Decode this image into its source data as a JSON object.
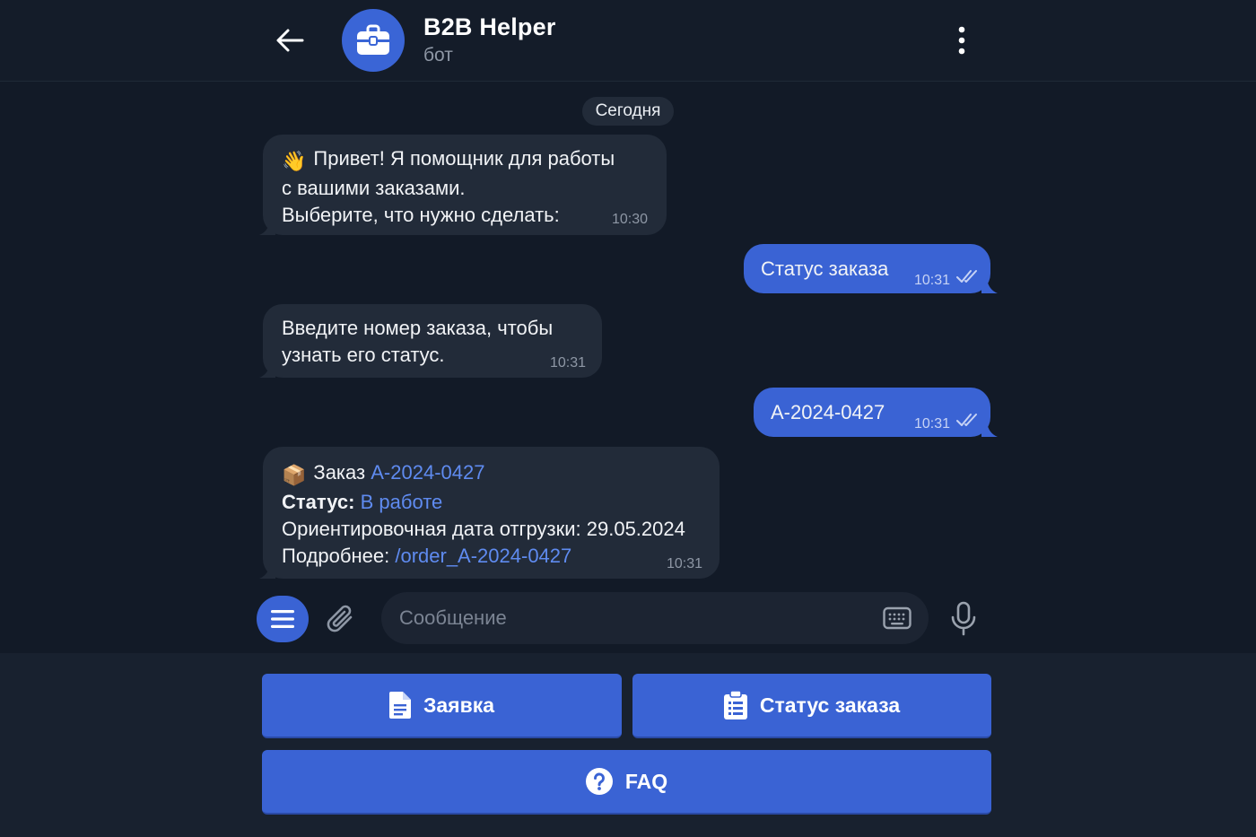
{
  "header": {
    "title": "B2B Helper",
    "subtitle": "бот",
    "back_icon": "arrow-left-icon",
    "avatar_icon": "briefcase-icon",
    "menu_icon": "more-vertical-icon"
  },
  "date_divider": "Сегодня",
  "messages": [
    {
      "direction": "in",
      "emoji": "👋",
      "lines": [
        "Привет! Я помощник для работы",
        "с вашими заказами.",
        "Выберите, что нужно сделать:"
      ],
      "time": "10:30"
    },
    {
      "direction": "out",
      "text": "Статус заказа",
      "time": "10:31",
      "read_icon": "double-check-icon"
    },
    {
      "direction": "in",
      "lines": [
        "Введите номер заказа, чтобы",
        "узнать его статус."
      ],
      "time": "10:31"
    },
    {
      "direction": "out",
      "text": "A-2024-0427",
      "time": "10:31",
      "read_icon": "double-check-icon"
    },
    {
      "direction": "in",
      "emoji": "📦",
      "order_prefix": "Заказ",
      "order_id": "A-2024-0427",
      "status_label": "Статус:",
      "status_value": "В работе",
      "ship_line": "Ориентировочная дата отгрузки: 29.05.2024",
      "details_label": "Подробнее:",
      "details_link": "/order_A-2024-0427",
      "time": "10:31"
    }
  ],
  "composer": {
    "placeholder": "Сообщение",
    "value": "",
    "menu_icon": "hamburger-menu-icon",
    "attach_icon": "paperclip-icon",
    "keyboard_icon": "keyboard-icon",
    "mic_icon": "microphone-icon"
  },
  "keyboard": {
    "buttons": [
      {
        "label": "Заявка",
        "icon": "document-icon"
      },
      {
        "label": "Статус заказа",
        "icon": "clipboard-list-icon"
      },
      {
        "label": "FAQ",
        "icon": "question-circle-icon"
      }
    ]
  },
  "colors": {
    "background": "#121a27",
    "bubble_in": "#222b39",
    "bubble_out": "#3a63d4",
    "accent": "#3a63d4",
    "link": "#5f8bf0"
  }
}
